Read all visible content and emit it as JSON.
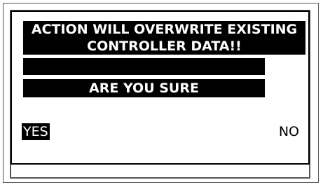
{
  "dialog": {
    "warning_line1": "ACTION WILL OVERWRITE EXISTING",
    "warning_line2": "CONTROLLER DATA!!",
    "blank_line": "",
    "confirm_text": "ARE YOU SURE",
    "options": {
      "yes_label": "YES",
      "no_label": "NO",
      "selected": "YES"
    }
  }
}
